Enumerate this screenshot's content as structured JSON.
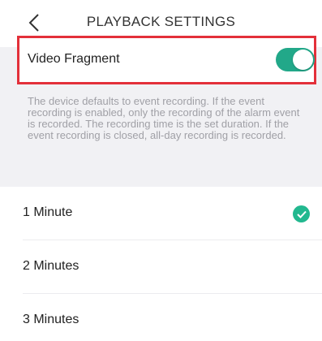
{
  "header": {
    "title": "PLAYBACK SETTINGS",
    "back_icon": "chevron-left-icon"
  },
  "video_fragment": {
    "label": "Video Fragment",
    "enabled": true,
    "toggle_color": "#22a889"
  },
  "description": "The device defaults to event recording. If the event recording is enabled, only the recording of the alarm event is recorded. The recording time is the set duration. If the event recording is closed, all-day recording is recorded.",
  "options": [
    {
      "label": "1 Minute",
      "selected": true
    },
    {
      "label": "2 Minutes",
      "selected": false
    },
    {
      "label": "3 Minutes",
      "selected": false
    }
  ],
  "colors": {
    "accent": "#22b88f",
    "highlight_border": "#e3303a",
    "section_background": "#f1f1f4",
    "description_text": "#a0a0a6"
  }
}
